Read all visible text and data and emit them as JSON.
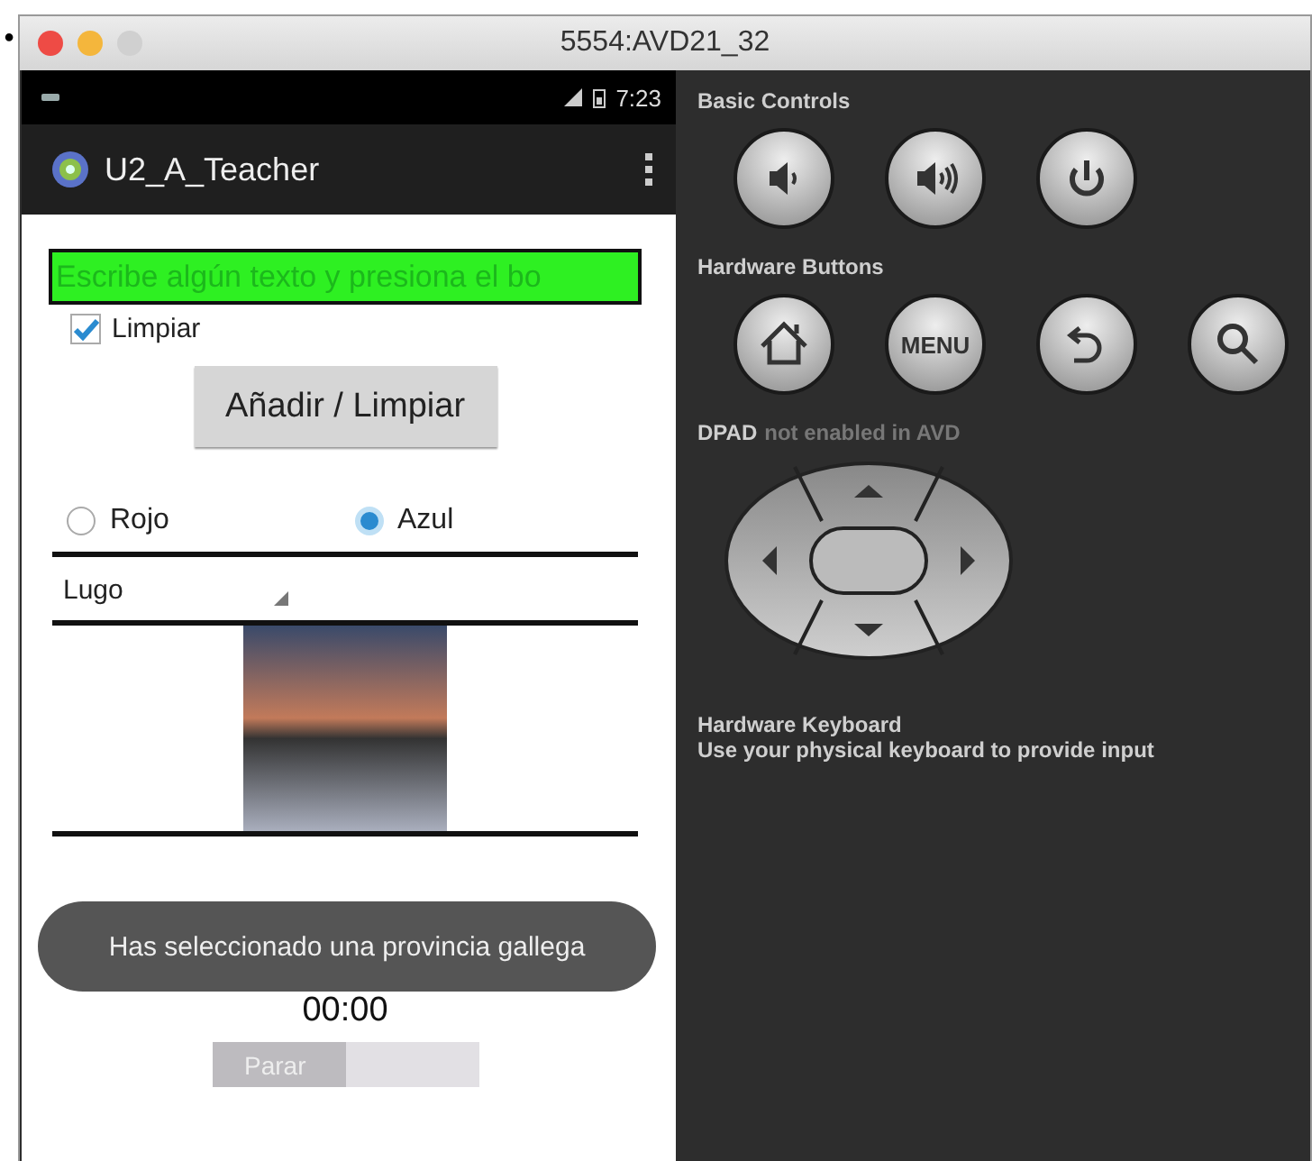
{
  "bullet": "•",
  "window": {
    "title": "5554:AVD21_32",
    "traffic_lights": [
      {
        "color": "#ee4b45"
      },
      {
        "color": "#f4b63c"
      },
      {
        "color": "#d0d0d0"
      }
    ]
  },
  "status_bar": {
    "time": "7:23"
  },
  "action_bar": {
    "title": "U2_A_Teacher"
  },
  "app": {
    "text_field": {
      "value": "Escribe algún texto y presiona el bo"
    },
    "checkbox": {
      "label": "Limpiar",
      "checked": true
    },
    "button": {
      "label": "Añadir / Limpiar"
    },
    "radios": [
      {
        "label": "Rojo",
        "selected": false
      },
      {
        "label": "Azul",
        "selected": true
      }
    ],
    "spinner": {
      "value": "Lugo"
    },
    "toast": "Has seleccionado una provincia gallega",
    "timer": "00:00",
    "progress": {
      "label": "Parar",
      "level": 0.5
    }
  },
  "controls": {
    "basic_title": "Basic Controls",
    "basic_buttons": [
      {
        "kind": "volume-down"
      },
      {
        "kind": "volume-up"
      },
      {
        "kind": "power"
      }
    ],
    "hardware_title": "Hardware Buttons",
    "hardware_buttons": [
      {
        "kind": "home"
      },
      {
        "kind": "menu",
        "label": "MENU"
      },
      {
        "kind": "back"
      },
      {
        "kind": "search"
      }
    ],
    "dpad_title": "DPAD",
    "dpad_note": "not enabled in AVD",
    "keyboard_title": "Hardware Keyboard",
    "keyboard_note": "Use your physical keyboard to provide input"
  }
}
